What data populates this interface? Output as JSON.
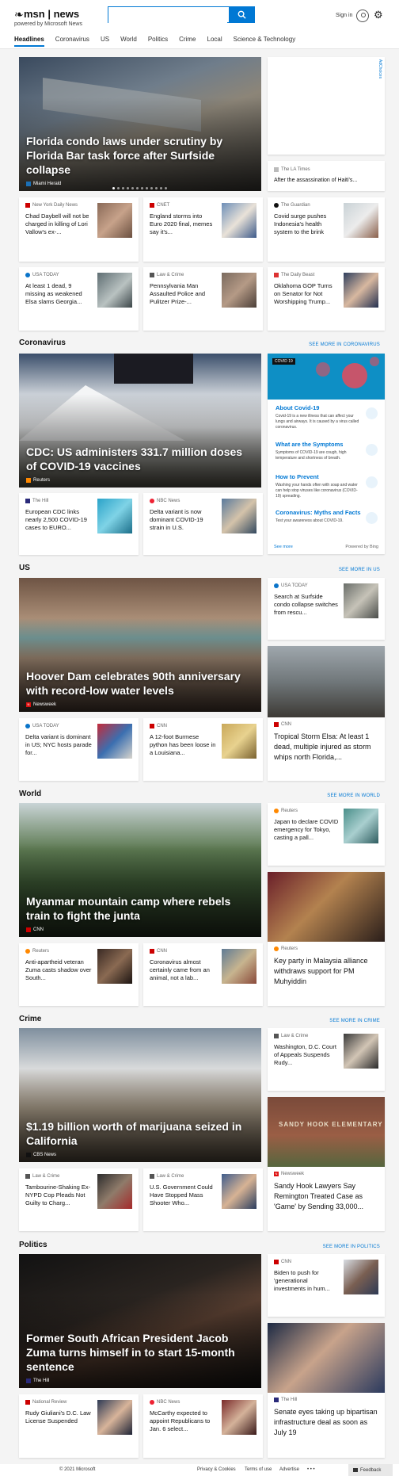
{
  "header": {
    "brand": "msn | news",
    "powered_by": "powered by Microsoft News",
    "search_value": "",
    "sign_in": "Sign in"
  },
  "nav": [
    "Headlines",
    "Coronavirus",
    "US",
    "World",
    "Politics",
    "Crime",
    "Local",
    "Science & Technology"
  ],
  "ad_label": "AdChoices",
  "headlines": {
    "hero": {
      "title": "Florida condo laws under scrutiny by Florida Bar task force after Surfside collapse",
      "source": "Miami Herald"
    },
    "right_small": {
      "source": "The LA Times",
      "title": "After the assassination of Haiti's..."
    },
    "cards": [
      {
        "source": "New York Daily News",
        "title": "Chad Daybell will not be charged in killing of Lori Vallow's ex-..."
      },
      {
        "source": "CNET",
        "title": "England storms into Euro 2020 final, memes say it's..."
      },
      {
        "source": "The Guardian",
        "title": "Covid surge pushes Indonesia's health system to the brink"
      },
      {
        "source": "USA TODAY",
        "title": "At least 1 dead, 9 missing as weakened Elsa slams Georgia..."
      },
      {
        "source": "Law & Crime",
        "title": "Pennsylvania Man Assaulted Police and Pulitzer Prize-..."
      },
      {
        "source": "The Daily Beast",
        "title": "Oklahoma GOP Turns on Senator for Not Worshipping Trump..."
      }
    ]
  },
  "coronavirus": {
    "section_title": "Coronavirus",
    "see_more": "SEE MORE IN CORONAVIRUS",
    "hero": {
      "title": "CDC: US administers 331.7 million doses of COVID-19 vaccines",
      "source": "Reuters"
    },
    "cards": [
      {
        "source": "The Hill",
        "title": "European CDC links nearly 2,500 COVID-19 cases to EURO..."
      },
      {
        "source": "NBC News",
        "title": "Delta variant is now dominant COVID-19 strain in U.S."
      }
    ],
    "panel": {
      "tag": "COVID 19",
      "items": [
        {
          "heading": "About Covid-19",
          "desc": "Covid-19 is a new illness that can affect your lungs and airways. It is caused by a virus called coronavirus."
        },
        {
          "heading": "What are the Symptoms",
          "desc": "Symptoms of COVID-19 are cough, high temperature and shortness of breath."
        },
        {
          "heading": "How to Prevent",
          "desc": "Washing your hands often with soap and water can help stop viruses like coronavirus (COVID-19) spreading."
        },
        {
          "heading": "Coronavirus: Myths and Facts",
          "desc": "Test your awareness about COVID-19."
        }
      ],
      "see_more": "See more",
      "powered": "Powered by Bing"
    }
  },
  "us": {
    "section_title": "US",
    "see_more": "SEE MORE IN US",
    "hero": {
      "title": "Hoover Dam celebrates 90th anniversary with record-low water levels",
      "source": "Newsweek"
    },
    "right_small": {
      "source": "USA TODAY",
      "title": "Search at Surfside condo collapse switches from rescu..."
    },
    "right_big": {
      "source": "CNN",
      "title": "Tropical Storm Elsa: At least 1 dead, multiple injured as storm whips north Florida,..."
    },
    "cards": [
      {
        "source": "USA TODAY",
        "title": "Delta variant is dominant in US; NYC hosts parade for..."
      },
      {
        "source": "CNN",
        "title": "A 12-foot Burmese python has been loose in a Louisiana..."
      }
    ]
  },
  "world": {
    "section_title": "World",
    "see_more": "SEE MORE IN WORLD",
    "hero": {
      "title": "Myanmar mountain camp where rebels train to fight the junta",
      "source": "CNN"
    },
    "right_small": {
      "source": "Reuters",
      "title": "Japan to declare COVID emergency for Tokyo, casting a pall..."
    },
    "right_big": {
      "source": "Reuters",
      "title": "Key party in Malaysia alliance withdraws support for PM Muhyiddin"
    },
    "cards": [
      {
        "source": "Reuters",
        "title": "Anti-apartheid veteran Zuma casts shadow over South..."
      },
      {
        "source": "CNN",
        "title": "Coronavirus almost certainly came from an animal, not a lab..."
      }
    ]
  },
  "crime": {
    "section_title": "Crime",
    "see_more": "SEE MORE IN CRIME",
    "hero": {
      "title": "$1.19 billion worth of marijuana seized in California",
      "source": "CBS News"
    },
    "right_small": {
      "source": "Law & Crime",
      "title": "Washington, D.C. Court of Appeals Suspends Rudy..."
    },
    "right_big": {
      "source": "Newsweek",
      "title": "Sandy Hook Lawyers Say Remington Treated Case as 'Game' by Sending 33,000...",
      "sign": "SANDY HOOK ELEMENTARY"
    },
    "cards": [
      {
        "source": "Law & Crime",
        "title": "Tambourine-Shaking Ex-NYPD Cop Pleads Not Guilty to Charg..."
      },
      {
        "source": "Law & Crime",
        "title": "U.S. Government Could Have Stopped Mass Shooter Who..."
      }
    ]
  },
  "politics": {
    "section_title": "Politics",
    "see_more": "SEE MORE IN POLITICS",
    "hero": {
      "title": "Former South African President Jacob Zuma turns himself in to start 15-month sentence",
      "source": "The Hill"
    },
    "right_small": {
      "source": "CNN",
      "title": "Biden to push for 'generational investments in hum..."
    },
    "right_big": {
      "source": "The Hill",
      "title": "Senate eyes taking up bipartisan infrastructure deal as soon as July 19"
    },
    "cards": [
      {
        "source": "National Review",
        "title": "Rudy Giuliani's D.C. Law License Suspended"
      },
      {
        "source": "NBC News",
        "title": "McCarthy expected to appoint Republicans to Jan. 6 select..."
      }
    ]
  },
  "footer": {
    "copyright": "© 2021 Microsoft",
    "privacy": "Privacy & Cookies",
    "terms": "Terms of use",
    "advertise": "Advertise",
    "more": "• • •",
    "feedback": "Feedback"
  }
}
